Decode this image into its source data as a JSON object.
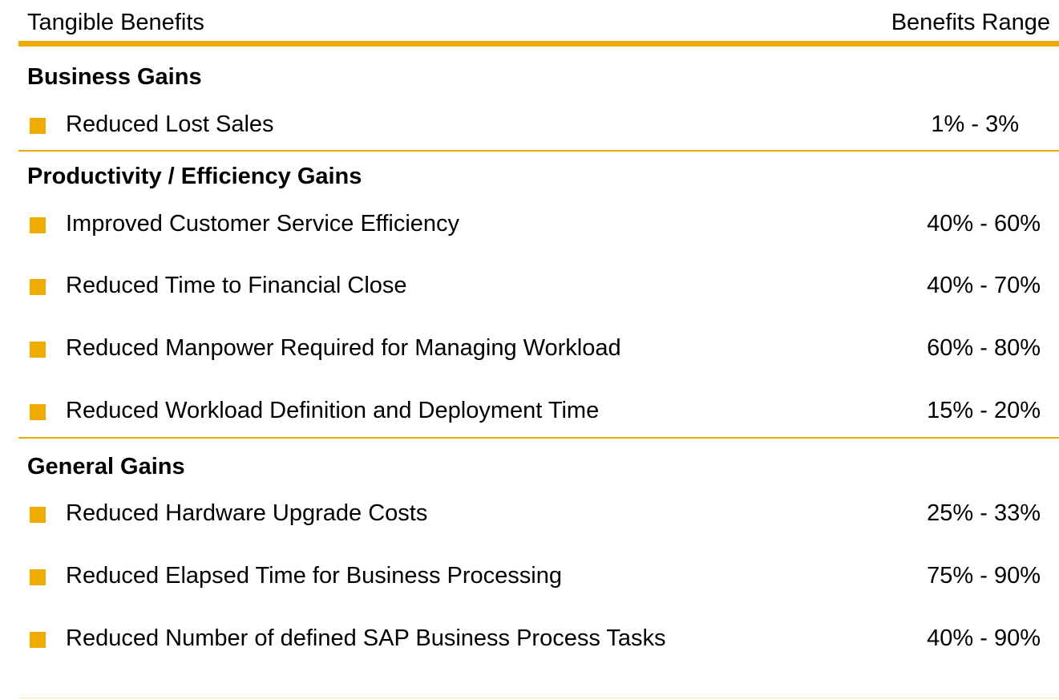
{
  "header": {
    "left_label": "Tangible Benefits",
    "right_label": "Benefits Range"
  },
  "colors": {
    "accent": "#f0ab00",
    "text": "#000000",
    "background": "#ffffff"
  },
  "sections": [
    {
      "title": "Business Gains",
      "items": [
        {
          "label": "Reduced Lost Sales",
          "range": "1% - 3%"
        }
      ]
    },
    {
      "title": "Productivity / Efficiency Gains",
      "items": [
        {
          "label": "Improved Customer Service Efficiency",
          "range": "40% - 60%"
        },
        {
          "label": "Reduced Time to Financial Close",
          "range": "40% - 70%"
        },
        {
          "label": "Reduced Manpower Required for Managing Workload",
          "range": "60% - 80%"
        },
        {
          "label": "Reduced Workload Definition and Deployment Time",
          "range": "15% - 20%"
        }
      ]
    },
    {
      "title": "General Gains",
      "items": [
        {
          "label": "Reduced Hardware Upgrade Costs",
          "range": "25% - 33%"
        },
        {
          "label": "Reduced Elapsed Time for Business Processing",
          "range": "75% - 90%"
        },
        {
          "label": "Reduced Number of defined SAP Business Process Tasks",
          "range": "40% - 90%"
        }
      ]
    }
  ]
}
